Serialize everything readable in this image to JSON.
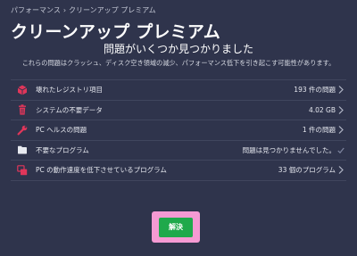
{
  "breadcrumb": {
    "parent": "パフォーマンス",
    "separator": "›",
    "current": "クリーンアップ プレミアム"
  },
  "page_title": "クリーンアップ プレミアム",
  "summary": {
    "title": "問題がいくつか見つかりました",
    "description": "これらの問題はクラッシュ、ディスク空き領域の減少、パフォーマンス低下を引き起こす可能性があります。"
  },
  "issues": [
    {
      "label": "壊れたレジストリ項目",
      "value": "193 件の問題",
      "icon": "registry-cube-icon"
    },
    {
      "label": "システムの不要データ",
      "value": "4.02 GB",
      "icon": "trash-icon"
    },
    {
      "label": "PC ヘルスの問題",
      "value": "1 件の問題",
      "icon": "wrench-icon"
    },
    {
      "label": "不要なプログラム",
      "value": "問題は見つかりませんでした。",
      "icon": "empty-folder-icon"
    },
    {
      "label": "PC の動作速度を低下させているプログラム",
      "value": "33 個のプログラム",
      "icon": "windows-stack-icon"
    }
  ],
  "resolve_label": "解決",
  "colors": {
    "background": "#2f344c",
    "accent_red": "#e0365a",
    "success_green": "#1fa94b",
    "highlight_pink": "#f59ad3"
  }
}
